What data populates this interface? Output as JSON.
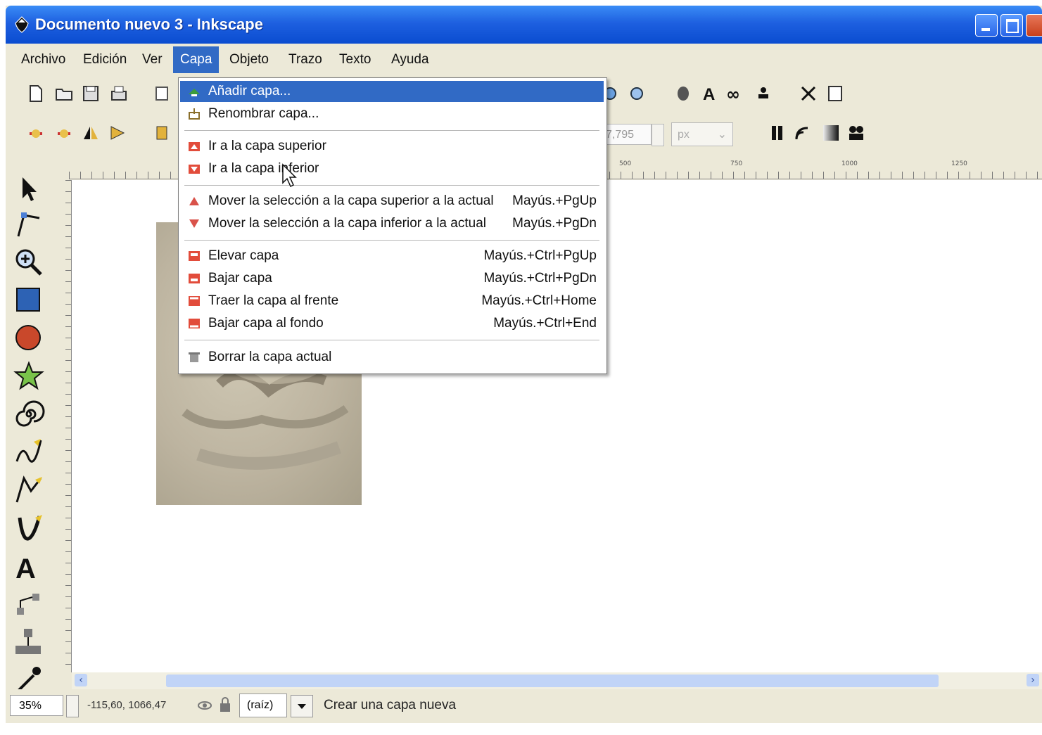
{
  "window": {
    "title": "Documento nuevo 3 - Inkscape"
  },
  "menubar": {
    "items": [
      "Archivo",
      "Edición",
      "Ver",
      "Capa",
      "Objeto",
      "Trazo",
      "Texto",
      "Ayuda"
    ],
    "active": "Capa"
  },
  "layer_menu": {
    "items": [
      {
        "label": "Añadir capa...",
        "shortcut": "",
        "highlighted": true,
        "icon": "add-layer-icon"
      },
      {
        "label": "Renombrar capa...",
        "shortcut": "",
        "icon": "rename-layer-icon"
      },
      {
        "label": "Ir a la capa superior",
        "shortcut": "",
        "icon": "layer-up-icon"
      },
      {
        "label": "Ir a la capa inferior",
        "shortcut": "",
        "icon": "layer-down-icon"
      },
      {
        "label": "Mover la selección a la capa superior a la actual",
        "shortcut": "Mayús.+PgUp",
        "icon": "move-selection-up-icon"
      },
      {
        "label": "Mover la selección a la capa inferior a la actual",
        "shortcut": "Mayús.+PgDn",
        "icon": "move-selection-down-icon"
      },
      {
        "label": "Elevar capa",
        "shortcut": "Mayús.+Ctrl+PgUp",
        "icon": "raise-layer-icon"
      },
      {
        "label": "Bajar capa",
        "shortcut": "Mayús.+Ctrl+PgDn",
        "icon": "lower-layer-icon"
      },
      {
        "label": "Traer la capa al frente",
        "shortcut": "Mayús.+Ctrl+Home",
        "icon": "layer-to-top-icon"
      },
      {
        "label": "Bajar capa al fondo",
        "shortcut": "Mayús.+Ctrl+End",
        "icon": "layer-to-bottom-icon"
      },
      {
        "label": "Borrar la capa actual",
        "shortcut": "",
        "icon": "delete-layer-icon"
      }
    ]
  },
  "toolbar": {
    "width_value": "7,795",
    "unit": "px"
  },
  "ruler": {
    "ticks": [
      "500",
      "750",
      "1000",
      "1250"
    ]
  },
  "statusbar": {
    "zoom": "35%",
    "coords": "-115,60, 1066,47",
    "layer": "(raíz)",
    "message": "Crear una capa nueva"
  },
  "colors": {
    "titlebar": "#1e60e0",
    "highlight": "#316ac5",
    "chrome": "#ece9d8"
  }
}
